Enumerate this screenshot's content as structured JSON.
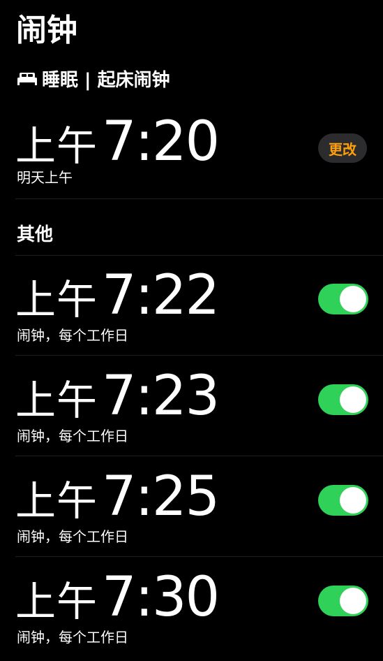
{
  "header": {
    "title": "闹钟"
  },
  "sleep": {
    "label": "睡眠 | 起床闹钟",
    "icon": "bed-icon",
    "alarm": {
      "period": "上午",
      "time": "7:20",
      "subtitle": "明天上午",
      "change_label": "更改"
    }
  },
  "other": {
    "label": "其他",
    "alarms": [
      {
        "period": "上午",
        "time": "7:22",
        "subtitle": "闹钟，每个工作日",
        "enabled": true
      },
      {
        "period": "上午",
        "time": "7:23",
        "subtitle": "闹钟，每个工作日",
        "enabled": true
      },
      {
        "period": "上午",
        "time": "7:25",
        "subtitle": "闹钟，每个工作日",
        "enabled": true
      },
      {
        "period": "上午",
        "time": "7:30",
        "subtitle": "闹钟，每个工作日",
        "enabled": true
      }
    ]
  },
  "colors": {
    "background": "#000000",
    "toggle_on": "#30d158",
    "accent_orange": "#ff9f0a",
    "button_bg": "#2c2c2e"
  }
}
